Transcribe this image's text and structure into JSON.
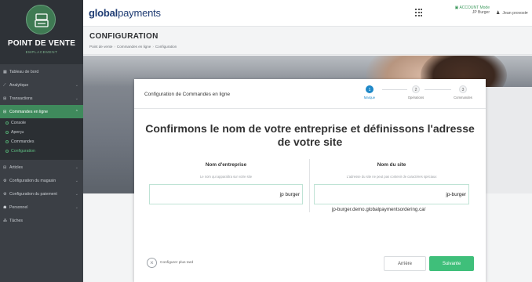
{
  "sidebar": {
    "brand_title": "POINT DE VENTE",
    "brand_subtitle": "EMPLACEMENT",
    "items": [
      {
        "label": "Tableau de bord",
        "icon": "dashboard-icon"
      },
      {
        "label": "Analytique",
        "icon": "chart-icon"
      },
      {
        "label": "Transactions",
        "icon": "transactions-icon"
      },
      {
        "label": "Commandes en ligne",
        "icon": "cart-icon"
      },
      {
        "label": "Articles",
        "icon": "cart-icon"
      },
      {
        "label": "Configuration du magasin",
        "icon": "gear-icon"
      },
      {
        "label": "Configuration du paiement",
        "icon": "gear-icon"
      },
      {
        "label": "Personnel",
        "icon": "people-icon"
      },
      {
        "label": "Tâches",
        "icon": "tasks-icon"
      }
    ],
    "sub_items": [
      {
        "label": "Console"
      },
      {
        "label": "Aperçu"
      },
      {
        "label": "Commandes"
      },
      {
        "label": "Configuration"
      }
    ]
  },
  "topbar": {
    "logo_bold": "global",
    "logo_light": "payments",
    "account_mode": "ACCOUNT Mode",
    "account_name": "JP Burger",
    "user_name": "Jean provost"
  },
  "header": {
    "title": "CONFIGURATION",
    "breadcrumb": [
      "Point de vente",
      "Commandes en ligne",
      "Configuration"
    ]
  },
  "card": {
    "title": "Configuration de Commandes en ligne",
    "steps": [
      {
        "num": "1",
        "label": "Marque"
      },
      {
        "num": "2",
        "label": "Opérations"
      },
      {
        "num": "3",
        "label": "Commandes"
      }
    ],
    "headline": "Confirmons le nom de votre entreprise et définissons l'adresse de votre site",
    "company": {
      "label": "Nom d'entreprise",
      "help": "Le nom qui apparaîtra sur votre site",
      "value": "jp burger"
    },
    "site": {
      "label": "Nom du site",
      "help": "L'adresse du site ne peut pas contenir de caractères spéciaux",
      "value": "jp-burger",
      "url": "jp-burger.demo.globalpaymentsordering.ca/"
    },
    "later_label": "Configurer plus tard",
    "back_label": "Arrière",
    "next_label": "Suivante"
  },
  "colors": {
    "accent_green": "#3fbf7a",
    "sidebar_active": "#3f8a5c",
    "step_active": "#1e88c8",
    "brand_navy": "#1f3c73"
  }
}
